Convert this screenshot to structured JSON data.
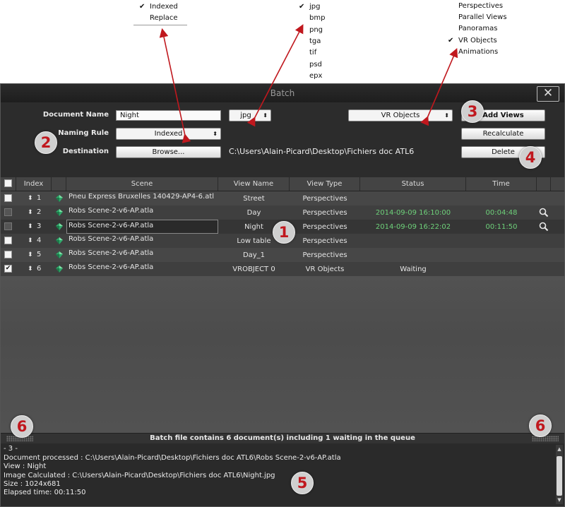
{
  "menus": {
    "naming": {
      "items": [
        "Indexed",
        "Replace"
      ],
      "checked": "Indexed"
    },
    "format": {
      "items": [
        "jpg",
        "bmp",
        "png",
        "tga",
        "tif",
        "psd",
        "epx"
      ],
      "checked": "jpg"
    },
    "viewtype": {
      "items": [
        "Perspectives",
        "Parallel Views",
        "Panoramas",
        "VR Objects",
        "Animations"
      ],
      "checked": "VR Objects"
    }
  },
  "window": {
    "title": "Batch",
    "close": "✕"
  },
  "settings": {
    "document_name_label": "Document Name",
    "document_name_value": "Night",
    "naming_rule_label": "Naming Rule",
    "naming_rule_value": "Indexed",
    "destination_label": "Destination",
    "browse_label": "Browse...",
    "destination_path": "C:\\Users\\Alain-Picard\\Desktop\\Fichiers doc ATL6",
    "format_value": "jpg",
    "view_type_value": "VR Objects",
    "add_views_label": "Add Views",
    "recalculate_label": "Recalculate",
    "delete_label": "Delete"
  },
  "table": {
    "headers": [
      "Index",
      "Scene",
      "View Name",
      "View Type",
      "Status",
      "Time"
    ],
    "rows": [
      {
        "checked": false,
        "index": "1",
        "scene": "Pneu Express Bruxelles 140429-AP4-6.atl",
        "view_name": "Street",
        "view_type": "Perspectives",
        "status": "",
        "time": ""
      },
      {
        "checked": false,
        "index": "2",
        "scene": "Robs Scene-2-v6-AP.atla",
        "view_name": "Day",
        "view_type": "Perspectives",
        "status": "2014-09-09 16:10:00",
        "time": "00:04:48"
      },
      {
        "checked": false,
        "index": "3",
        "scene": "Robs Scene-2-v6-AP.atla",
        "view_name": "Night",
        "view_type": "Perspectives",
        "status": "2014-09-09 16:22:02",
        "time": "00:11:50"
      },
      {
        "checked": false,
        "index": "4",
        "scene": "Robs Scene-2-v6-AP.atla",
        "view_name": "Low table",
        "view_type": "Perspectives",
        "status": "",
        "time": ""
      },
      {
        "checked": false,
        "index": "5",
        "scene": "Robs Scene-2-v6-AP.atla",
        "view_name": "Day_1",
        "view_type": "Perspectives",
        "status": "",
        "time": ""
      },
      {
        "checked": true,
        "index": "6",
        "scene": "Robs Scene-2-v6-AP.atla",
        "view_name": "VROBJECT 0",
        "view_type": "VR Objects",
        "status": "Waiting",
        "time": ""
      }
    ]
  },
  "status_bar": "Batch file contains 6 document(s) including 1 waiting in the queue",
  "log": [
    "- 3 -",
    "Document processed : C:\\Users\\Alain-Picard\\Desktop\\Fichiers doc ATL6\\Robs Scene-2-v6-AP.atla",
    "View : Night",
    "Image Calculated : C:\\Users\\Alain-Picard\\Desktop\\Fichiers doc ATL6\\Night.jpg",
    "Size : 1024x681",
    "Elapsed time: 00:11:50"
  ],
  "callouts": [
    "1",
    "2",
    "3",
    "4",
    "5",
    "6",
    "6"
  ],
  "colors": {
    "accent_red": "#c0181e",
    "status_green": "#6ed17a",
    "gem_green": "#2fa86a"
  },
  "icons": {
    "checkmark": "✔",
    "updown": "⬍",
    "search": "magnifier-icon",
    "gem": "scene-gem-icon"
  }
}
